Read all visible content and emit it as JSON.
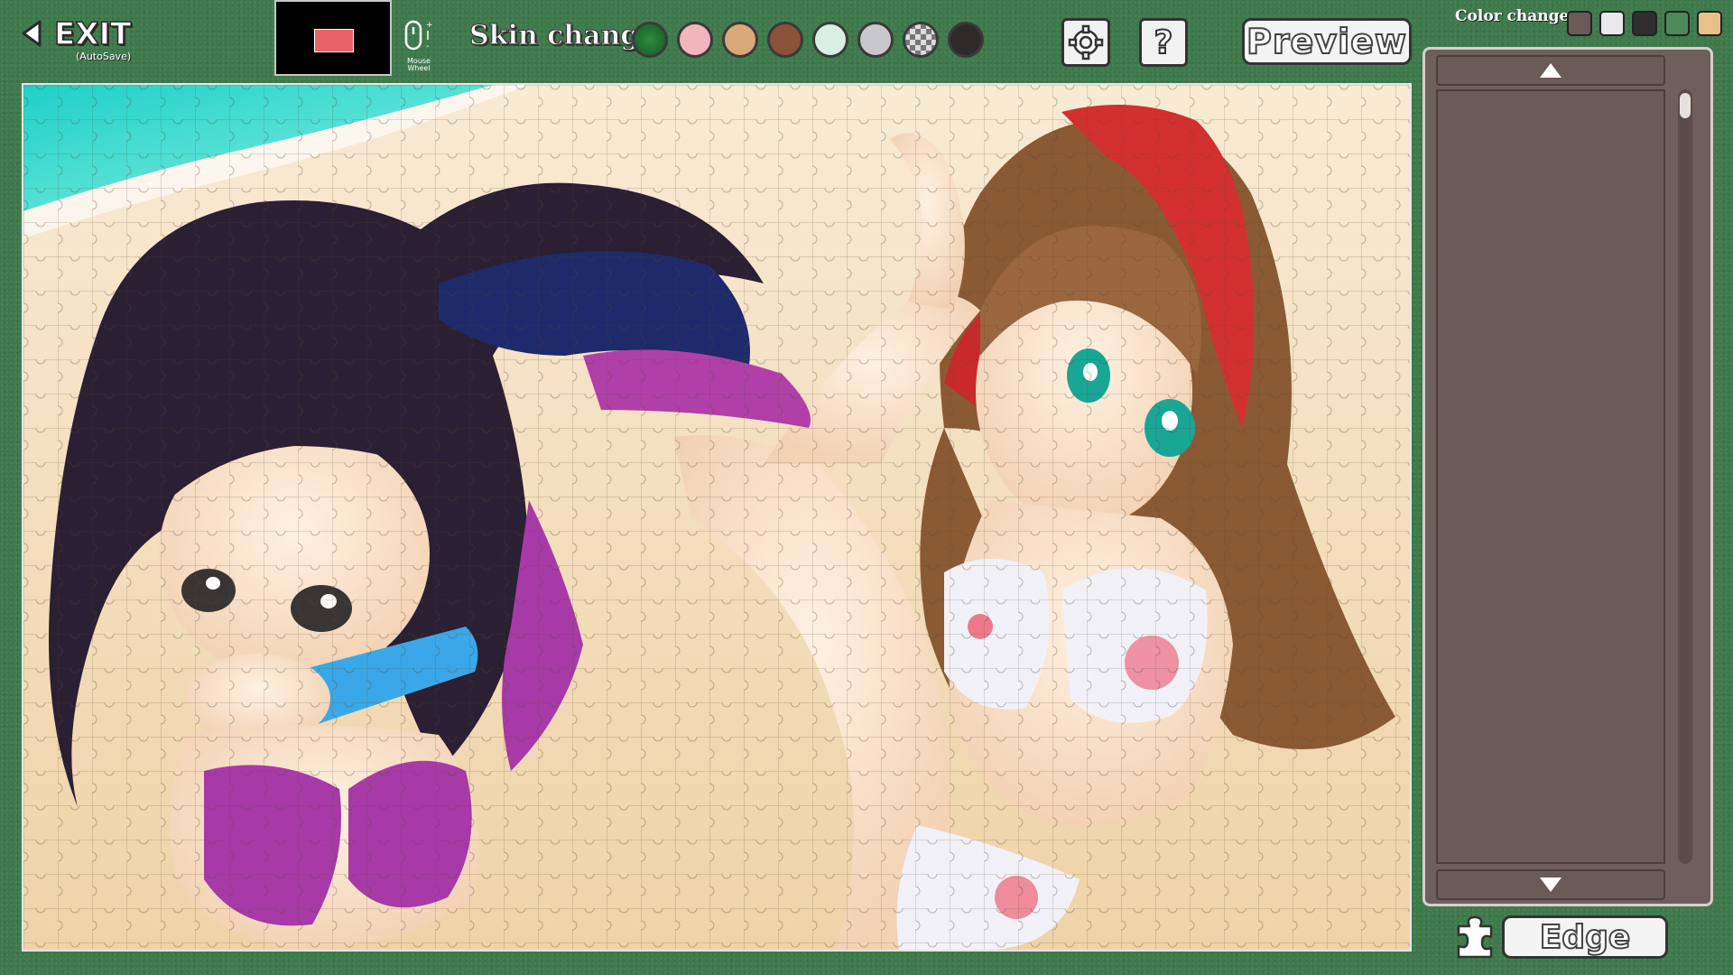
{
  "toolbar": {
    "exit_label": "EXIT",
    "exit_sub": "(AutoSave)",
    "wheel_label": "Mouse Wheel",
    "skin_label": "Skin change",
    "skins": [
      {
        "name": "green-felt",
        "color": "#1f6a2e"
      },
      {
        "name": "pink",
        "color": "#f2b4bd"
      },
      {
        "name": "tan",
        "color": "#d9a877"
      },
      {
        "name": "brown",
        "color": "#8a5238"
      },
      {
        "name": "mint",
        "color": "#d9efe6"
      },
      {
        "name": "silver",
        "color": "#c8c8cc"
      },
      {
        "name": "checker",
        "color": "#5a5a5a"
      },
      {
        "name": "dark",
        "color": "#2e2a2a"
      }
    ],
    "help_label": "?",
    "preview_label": "Preview"
  },
  "color_change": {
    "label": "Color change",
    "swatches": [
      "#6b5a58",
      "#e8e8ee",
      "#2e2e2e",
      "#4d8a5a",
      "#e8c08a"
    ]
  },
  "panel": {
    "edge_label": "Edge"
  }
}
